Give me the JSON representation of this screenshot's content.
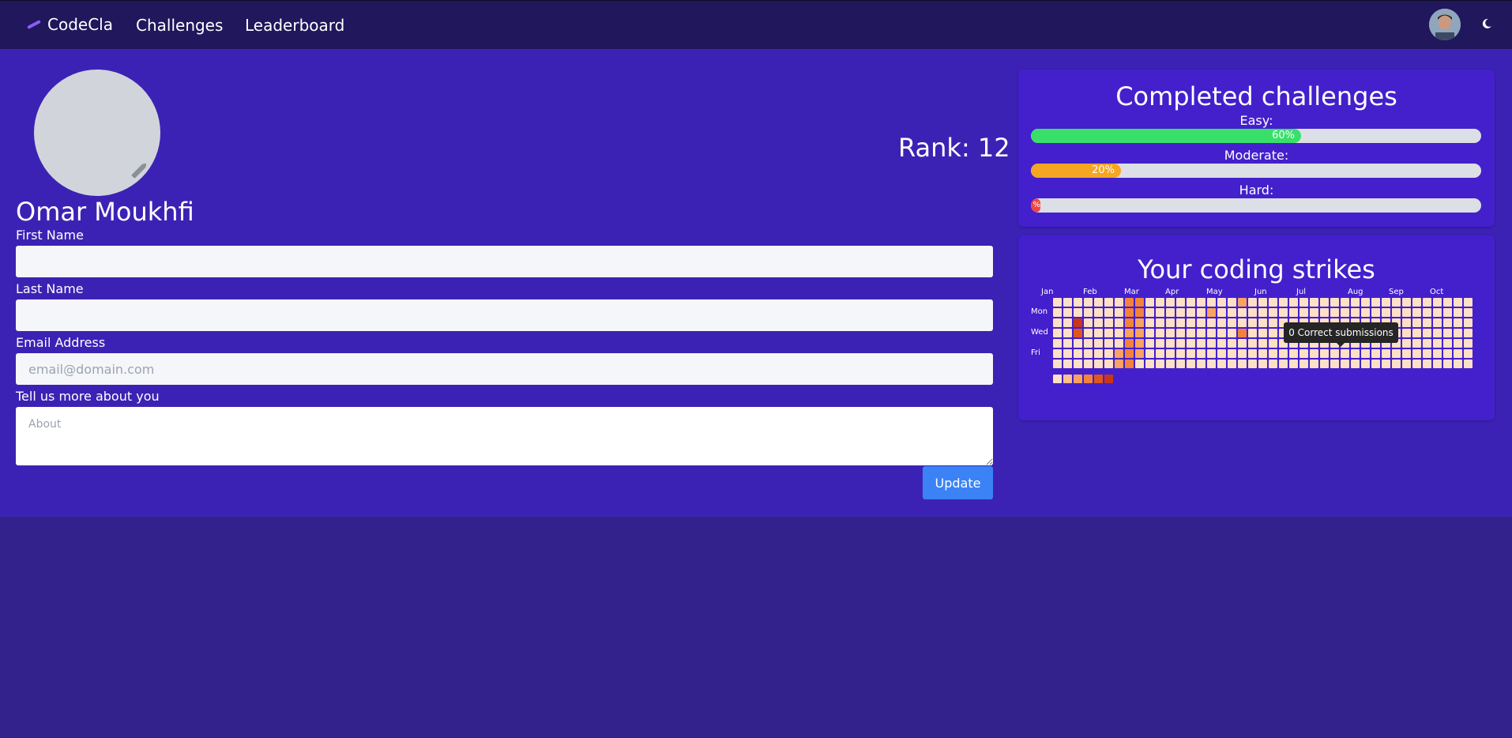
{
  "nav": {
    "brand": "CodeCla",
    "links": [
      "Challenges",
      "Leaderboard"
    ],
    "avatar_icon": "user-avatar",
    "theme_icon": "moon-icon"
  },
  "profile": {
    "name": "Omar Moukhfi",
    "rank_text": "Rank: 12",
    "edit_icon": "pencil-icon"
  },
  "form": {
    "first_name_label": "First Name",
    "first_name_value": "",
    "last_name_label": "Last Name",
    "last_name_value": "",
    "email_label": "Email Address",
    "email_placeholder": "email@domain.com",
    "about_label": "Tell us more about you",
    "about_placeholder": "About",
    "update_label": "Update"
  },
  "completed": {
    "title": "Completed challenges",
    "items": [
      {
        "label": "Easy:",
        "percent": 60,
        "text": "60%",
        "color": "#38e06a"
      },
      {
        "label": "Moderate:",
        "percent": 20,
        "text": "20%",
        "color": "#f5a623"
      },
      {
        "label": "Hard:",
        "percent": 0,
        "text": "%",
        "color": "#ef4444"
      }
    ]
  },
  "strikes": {
    "title": "Your coding strikes",
    "months": [
      "Jan",
      "Feb",
      "Mar",
      "Apr",
      "May",
      "Jun",
      "Jul",
      "Aug",
      "Sep",
      "Oct"
    ],
    "days": [
      "Mon",
      "Wed",
      "Fri"
    ],
    "tooltip": "0 Correct submissions",
    "legend_colors": [
      "#fde0c6",
      "#fcbf8d",
      "#f9a35e",
      "#f3823c",
      "#e0561d",
      "#c9361a"
    ],
    "active_cells": [
      {
        "week": 2,
        "day": 2,
        "level": 5
      },
      {
        "week": 2,
        "day": 3,
        "level": 4
      },
      {
        "week": 6,
        "day": 5,
        "level": 2
      },
      {
        "week": 6,
        "day": 6,
        "level": 2
      },
      {
        "week": 7,
        "day": 0,
        "level": 3
      },
      {
        "week": 7,
        "day": 1,
        "level": 3
      },
      {
        "week": 7,
        "day": 2,
        "level": 3
      },
      {
        "week": 7,
        "day": 3,
        "level": 2
      },
      {
        "week": 7,
        "day": 4,
        "level": 3
      },
      {
        "week": 7,
        "day": 5,
        "level": 3
      },
      {
        "week": 7,
        "day": 6,
        "level": 3
      },
      {
        "week": 8,
        "day": 0,
        "level": 3
      },
      {
        "week": 8,
        "day": 1,
        "level": 3
      },
      {
        "week": 8,
        "day": 2,
        "level": 2
      },
      {
        "week": 8,
        "day": 3,
        "level": 2
      },
      {
        "week": 8,
        "day": 4,
        "level": 2
      },
      {
        "week": 8,
        "day": 5,
        "level": 2
      },
      {
        "week": 15,
        "day": 1,
        "level": 2
      },
      {
        "week": 18,
        "day": 0,
        "level": 2
      },
      {
        "week": 18,
        "day": 3,
        "level": 3
      }
    ]
  }
}
